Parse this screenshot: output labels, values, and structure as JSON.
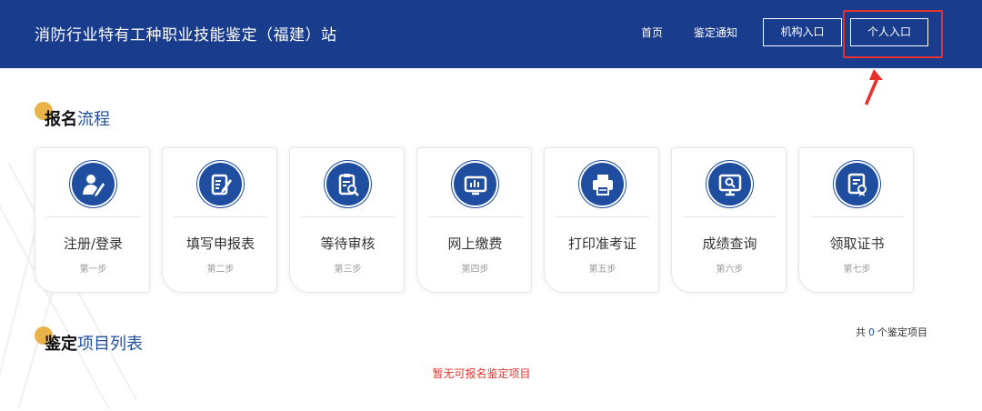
{
  "header": {
    "site_title": "消防行业特有工种职业技能鉴定（福建）站",
    "nav_home": "首页",
    "nav_notice": "鉴定通知",
    "btn_org": "机构入口",
    "btn_personal": "个人入口"
  },
  "process": {
    "title_a": "报名",
    "title_b": "流程",
    "steps": [
      {
        "name": "注册/登录",
        "num": "第一步",
        "icon": "user-edit-icon"
      },
      {
        "name": "填写申报表",
        "num": "第二步",
        "icon": "form-edit-icon"
      },
      {
        "name": "等待审核",
        "num": "第三步",
        "icon": "clipboard-search-icon"
      },
      {
        "name": "网上缴费",
        "num": "第四步",
        "icon": "online-payment-icon"
      },
      {
        "name": "打印准考证",
        "num": "第五步",
        "icon": "printer-icon"
      },
      {
        "name": "成绩查询",
        "num": "第六步",
        "icon": "monitor-search-icon"
      },
      {
        "name": "领取证书",
        "num": "第七步",
        "icon": "certificate-icon"
      }
    ]
  },
  "list": {
    "title_a": "鉴定",
    "title_b": "项目列表",
    "count_prefix": "共",
    "count": "0",
    "count_suffix": "个鉴定项目",
    "empty_message": "暂无可报名鉴定项目"
  },
  "colors": {
    "header_bg": "#1a3c8c",
    "accent_blue": "#1f4ea0",
    "accent_gold": "#e9b34a",
    "alert_red": "#e5322d"
  }
}
